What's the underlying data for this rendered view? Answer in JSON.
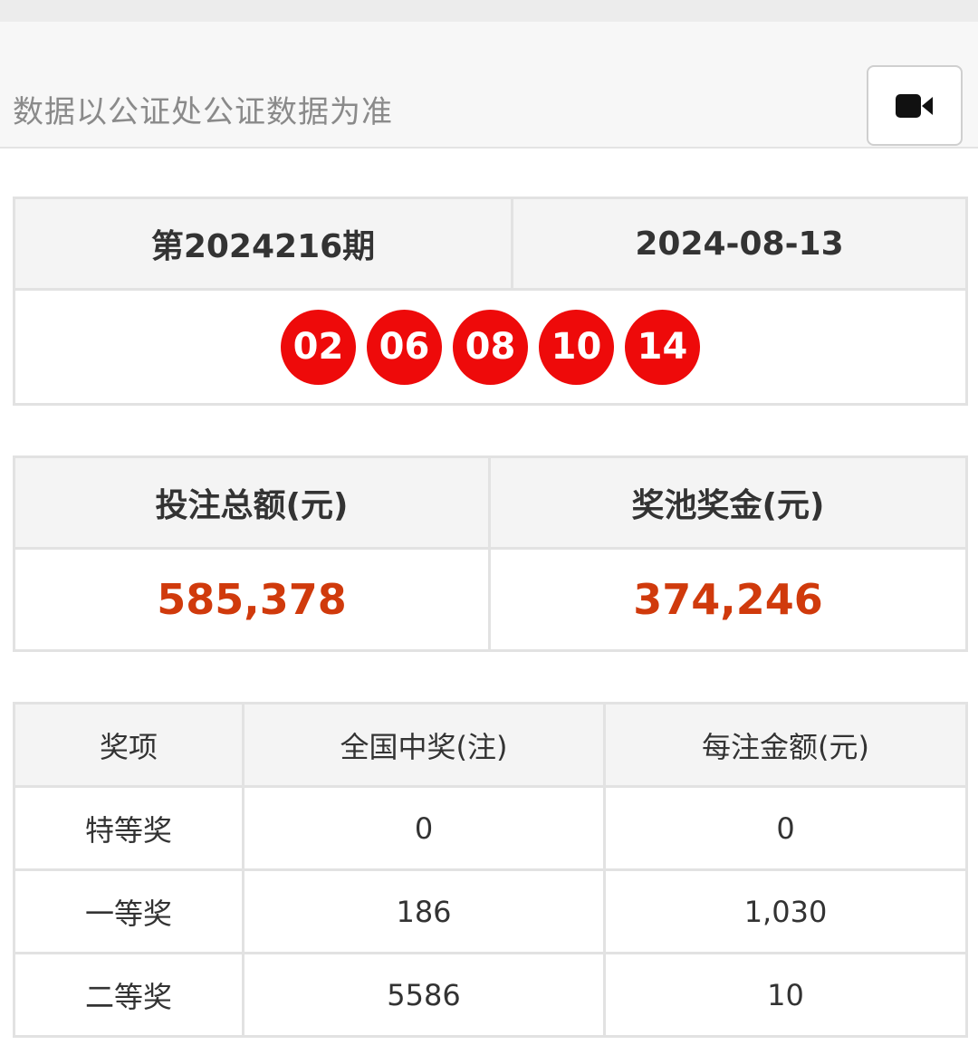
{
  "notice": "数据以公证处公证数据为准",
  "video_button_icon": "video-camera-icon",
  "draw": {
    "issue": "第2024216期",
    "date": "2024-08-13",
    "numbers": [
      "02",
      "06",
      "08",
      "10",
      "14"
    ],
    "ball_color": "#ee0a0a"
  },
  "sales": {
    "total_bet_label": "投注总额(元)",
    "pool_label": "奖池奖金(元)",
    "total_bet_value": "585,378",
    "pool_value": "374,246",
    "value_color": "#d03a0c"
  },
  "prizes": {
    "headers": [
      "奖项",
      "全国中奖(注)",
      "每注金额(元)"
    ],
    "rows": [
      {
        "name": "特等奖",
        "count": "0",
        "amount": "0"
      },
      {
        "name": "一等奖",
        "count": "186",
        "amount": "1,030"
      },
      {
        "name": "二等奖",
        "count": "5586",
        "amount": "10"
      }
    ]
  }
}
